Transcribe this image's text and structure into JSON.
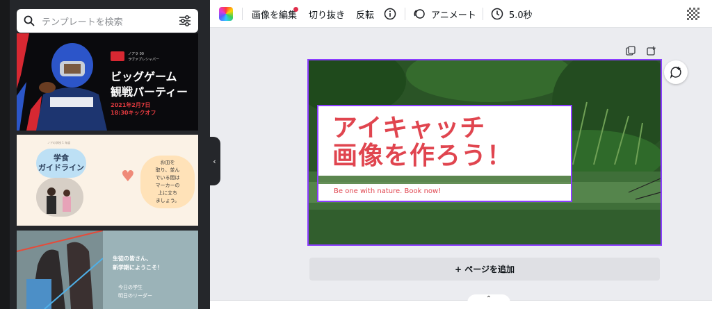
{
  "search": {
    "placeholder": "テンプレートを検索",
    "icon": "search-icon",
    "filter_icon": "sliders-icon"
  },
  "templates": [
    {
      "title": "ビッグゲーム\n観戦パーティー",
      "small_text": "ノアラ 00\nラヴァプレシャパー",
      "date": "2021年2月7日\n18:30キックオフ",
      "colors": {
        "accent": "#d72832",
        "background": "#0a0a0d"
      }
    },
    {
      "small_text": "ノアの学校 1 年度",
      "bubble": "学食\nガイドライン",
      "note": "お皿を\n取り、並ん\nでいる間は\nマーカーの\n上に立ち\nましょう。"
    },
    {
      "title": "生徒の皆さん、\n新学期にようこそ！",
      "sub": "今日の学生\n明日のリーダー"
    }
  ],
  "toolbar": {
    "edit_image": "画像を編集",
    "crop": "切り抜き",
    "flip": "反転",
    "info_icon": "info-icon",
    "animate": "アニメート",
    "duration": "5.0秒",
    "transparency_icon": "checker-icon"
  },
  "canvas": {
    "headline": "アイキャッチ\n画像を作ろう！",
    "tagline": "Be one with nature. Book now!",
    "headline_color": "#e0454f",
    "selection_color": "#8b3dff"
  },
  "add_page": "+ ページを追加",
  "collapse_icon": "chevron-left-icon",
  "expand_icon": "chevron-up-icon"
}
